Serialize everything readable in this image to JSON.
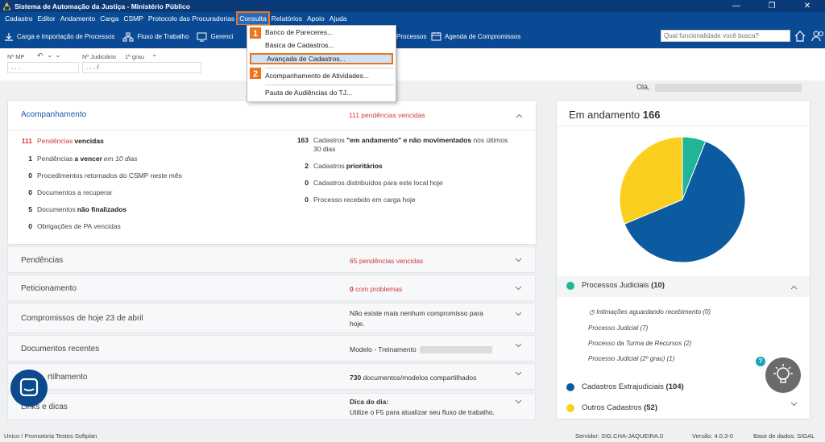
{
  "window": {
    "title": "Sistema de Automação da Justiça - Ministério Público",
    "minimize": "—",
    "maximize": "❐",
    "close": "✕"
  },
  "menu": [
    "Cadastro",
    "Editor",
    "Andamento",
    "Carga",
    "CSMP",
    "Protocolo das Procuradorias",
    "Consulta",
    "Relatórios",
    "Apoio",
    "Ajuda"
  ],
  "toolbar": {
    "carga": "Carga e Importação de Processos",
    "fluxo": "Fluxo de Trabalho",
    "gerencia": "Gerenci",
    "processos": "Processos",
    "agenda": "Agenda de Compromissos",
    "search_placeholder": "Qual funcionalidade você busca?"
  },
  "consulta_menu": {
    "items": [
      "Banco de Pareceres...",
      "Básica de Cadastros...",
      "Avançada de Cadastros...",
      "Acompanhamento de Atividades...",
      "Pauta de Audiências do TJ..."
    ],
    "badge1": "1",
    "badge2": "2"
  },
  "filters": {
    "mp_label": "Nº MP",
    "judiciario_label": "Nº Judiciário",
    "grau": "1º grau",
    "mp_value": ". . .",
    "jud_value": ". . . /"
  },
  "greeting": "Olá,",
  "acompanhamento": {
    "title": "Acompanhamento",
    "summary": "111 pendências vencidas",
    "left": [
      {
        "num": "111",
        "pre": "Pendências ",
        "bold": "vencidas",
        "post": ""
      },
      {
        "num": "1",
        "pre": "Pendências ",
        "bold": "a vencer",
        "post": " em 10 dias"
      },
      {
        "num": "0",
        "pre": "Procedimentos retornados do CSMP neste mês",
        "bold": "",
        "post": ""
      },
      {
        "num": "0",
        "pre": "Documentos a recuperar",
        "bold": "",
        "post": ""
      },
      {
        "num": "5",
        "pre": "Documentos ",
        "bold": "não finalizados",
        "post": ""
      },
      {
        "num": "0",
        "pre": "Obrigações de PA vencidas",
        "bold": "",
        "post": ""
      }
    ],
    "right": [
      {
        "num": "163",
        "pre": "Cadastros ",
        "bold": "\"em andamento\" e não movimentados",
        "post": " nos últimos",
        "line2": "30 dias"
      },
      {
        "num": "2",
        "pre": "Cadastros ",
        "bold": "prioritários",
        "post": ""
      },
      {
        "num": "0",
        "pre": "Cadastros distribuídos para este local hoje",
        "bold": "",
        "post": ""
      },
      {
        "num": "0",
        "pre": "Processo recebido em carga hoje",
        "bold": "",
        "post": ""
      }
    ]
  },
  "rows": [
    {
      "title": "Pendências",
      "mid": "65 pendências vencidas",
      "mid_num": "65",
      "mid_text": " pendências vencidas"
    },
    {
      "title": "Peticionamento",
      "mid_num": "0",
      "mid_text": " com problemas"
    },
    {
      "title": "Compromissos de hoje 23 de abril",
      "line1": "Não existe mais nenhum compromisso para",
      "line2": "hoje."
    },
    {
      "title": "Documentos recentes",
      "mid": "Modelo - Treinamento"
    },
    {
      "title": "rtilhamento",
      "mid_num": "730",
      "mid_text": " documentos/modelos compartilhados"
    },
    {
      "title": "Links e dicas",
      "tip_title": "Dica do dia:",
      "tip_text": "Utilize o F5 para atualizar seu fluxo de trabalho."
    }
  ],
  "andamento": {
    "label": "Em andamento",
    "count": "166",
    "processos_label": "Processos Judiciais",
    "processos_count": "(10)",
    "intimacoes": "Intimações aguardando recebimento (0)",
    "subs": [
      "Processo Judicial (7)",
      "Processo da Turma de Recursos (2)",
      "Processo Judicial (2º grau) (1)"
    ],
    "extra_label": "Cadastros Extrajudiciais",
    "extra_count": "(104)",
    "outros_label": "Outros Cadastros",
    "outros_count": "(52)"
  },
  "chart_data": {
    "type": "pie",
    "slices": [
      {
        "name": "Processos Judiciais",
        "value": 10,
        "color": "#20b597"
      },
      {
        "name": "Cadastros Extrajudiciais",
        "value": 104,
        "color": "#0c5aa0"
      },
      {
        "name": "Outros Cadastros",
        "value": 52,
        "color": "#fbcf1f"
      }
    ]
  },
  "status": {
    "left": "Unico / Promotoria Testes Softplan",
    "server": "Servidor: SIG.CHA-JAQUEIRA.0",
    "version": "Versão: 4.0.3-0",
    "db": "Base de dados: SIGAL"
  },
  "help": "?"
}
